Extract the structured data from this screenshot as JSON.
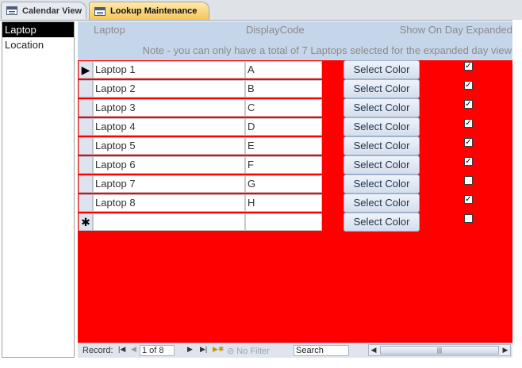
{
  "tabs": [
    {
      "label": "Calendar View",
      "icon": "form-icon"
    },
    {
      "label": "Lookup Maintenance",
      "icon": "form-icon",
      "active": true
    }
  ],
  "left_list": [
    "Laptop",
    "Location"
  ],
  "left_list_selected": "Laptop",
  "header": {
    "col_laptop": "Laptop",
    "col_code": "DisplayCode",
    "col_show": "Show On Day Expanded",
    "note": "Note - you can only have a total of 7 Laptops selected for the expanded day view"
  },
  "button_label": "Select Color",
  "rows": [
    {
      "name": "Laptop 1",
      "code": "A",
      "checked": true,
      "current": true
    },
    {
      "name": "Laptop 2",
      "code": "B",
      "checked": true
    },
    {
      "name": "Laptop 3",
      "code": "C",
      "checked": true
    },
    {
      "name": "Laptop 4",
      "code": "D",
      "checked": true
    },
    {
      "name": "Laptop 5",
      "code": "E",
      "checked": true
    },
    {
      "name": "Laptop 6",
      "code": "F",
      "checked": true
    },
    {
      "name": "Laptop 7",
      "code": "G",
      "checked": false
    },
    {
      "name": "Laptop 8",
      "code": "H",
      "checked": true
    },
    {
      "name": "",
      "code": "",
      "checked": false,
      "new": true
    }
  ],
  "selector_glyphs": {
    "current": "▶",
    "new": "✱"
  },
  "navbar": {
    "record_label": "Record:",
    "position": "1 of 8",
    "filter": "No Filter",
    "search": "Search"
  },
  "colors": {
    "form_background": "#ff0000",
    "header_background": "#c6d6ea"
  }
}
